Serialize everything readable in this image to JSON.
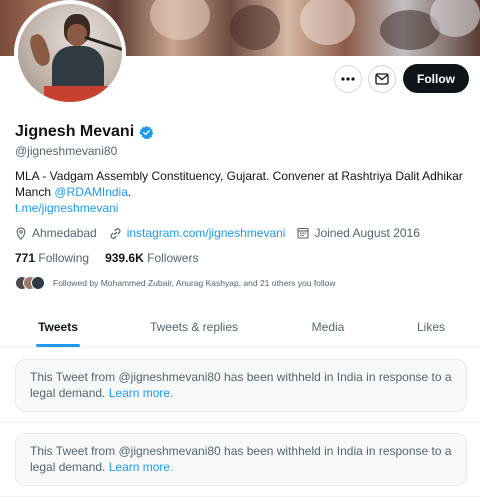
{
  "profile": {
    "name": "Jignesh Mevani",
    "handle": "@jigneshmevani80",
    "bio_text": "MLA - Vadgam Assembly Constituency, Gujarat. Convener at Rashtriya Dalit Adhikar Manch ",
    "bio_mention": "@RDAMIndia",
    "bio_period": ".",
    "bio_link": "t.me/jigneshmevani",
    "location": "Ahmedabad",
    "website": "instagram.com/jigneshmevani",
    "joined": "Joined August 2016",
    "following_count": "771",
    "following_label": "Following",
    "followers_count": "939.6K",
    "followers_label": "Followers",
    "followed_by": "Followed by Mohammed Zubair, Anurag Kashyap, and 21 others you follow"
  },
  "actions": {
    "more_icon": "more-icon",
    "message_icon": "message-icon",
    "follow_label": "Follow"
  },
  "tabs": [
    {
      "label": "Tweets",
      "active": true
    },
    {
      "label": "Tweets & replies",
      "active": false
    },
    {
      "label": "Media",
      "active": false
    },
    {
      "label": "Likes",
      "active": false
    }
  ],
  "notices": [
    {
      "text": "This Tweet from @jigneshmevani80 has been withheld in India in response to a legal demand.",
      "link": "Learn more."
    },
    {
      "text": "This Tweet from @jigneshmevani80 has been withheld in India in response to a legal demand.",
      "link": "Learn more."
    }
  ],
  "colors": {
    "accent": "#1d9bf0",
    "text_primary": "#0f1419",
    "text_secondary": "#536471",
    "follow_button_bg": "#0f1419"
  }
}
